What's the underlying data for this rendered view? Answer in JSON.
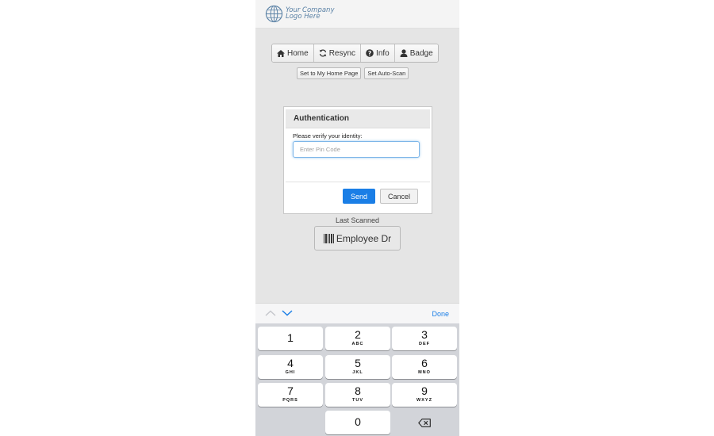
{
  "logo": {
    "line1": "Your Company",
    "line2": "Logo Here",
    "icon": "globe-icon"
  },
  "nav": [
    {
      "label": "Home",
      "icon": "home-icon"
    },
    {
      "label": "Resync",
      "icon": "refresh-icon"
    },
    {
      "label": "Info",
      "icon": "question-circle-icon"
    },
    {
      "label": "Badge",
      "icon": "user-icon"
    }
  ],
  "actions": {
    "home_page": "Set to My Home Page",
    "auto_scan": "Set Auto-Scan"
  },
  "auth": {
    "title": "Authentication",
    "prompt": "Please verify your identity:",
    "pin_placeholder": "Enter Pin Code",
    "pin_value": "",
    "send": "Send",
    "cancel": "Cancel"
  },
  "last_scanned": {
    "label": "Last Scanned",
    "value": "Employee Dr",
    "icon": "barcode-icon"
  },
  "keyboard": {
    "done": "Done",
    "keys": [
      {
        "num": "1",
        "letters": ""
      },
      {
        "num": "2",
        "letters": "ABC"
      },
      {
        "num": "3",
        "letters": "DEF"
      },
      {
        "num": "4",
        "letters": "GHI"
      },
      {
        "num": "5",
        "letters": "JKL"
      },
      {
        "num": "6",
        "letters": "MNO"
      },
      {
        "num": "7",
        "letters": "PQRS"
      },
      {
        "num": "8",
        "letters": "TUV"
      },
      {
        "num": "9",
        "letters": "WXYZ"
      },
      {
        "num": "0",
        "letters": ""
      }
    ]
  },
  "colors": {
    "accent": "#1a7ee6",
    "background": "#e5e5e5",
    "keyboard": "#d2d4d9"
  }
}
